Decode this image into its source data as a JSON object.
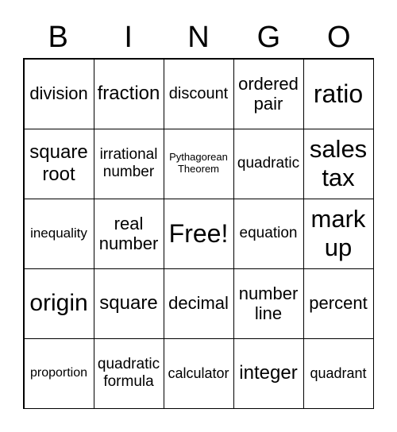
{
  "header": [
    "B",
    "I",
    "N",
    "G",
    "O"
  ],
  "cells": [
    "division",
    "fraction",
    "discount",
    "ordered pair",
    "ratio",
    "square root",
    "irrational number",
    "Pythagorean Theorem",
    "quadratic",
    "sales tax",
    "inequality",
    "real number",
    "Free!",
    "equation",
    "mark up",
    "origin",
    "square",
    "decimal",
    "number line",
    "percent",
    "proportion",
    "quadratic formula",
    "calculator",
    "integer",
    "quadrant"
  ]
}
